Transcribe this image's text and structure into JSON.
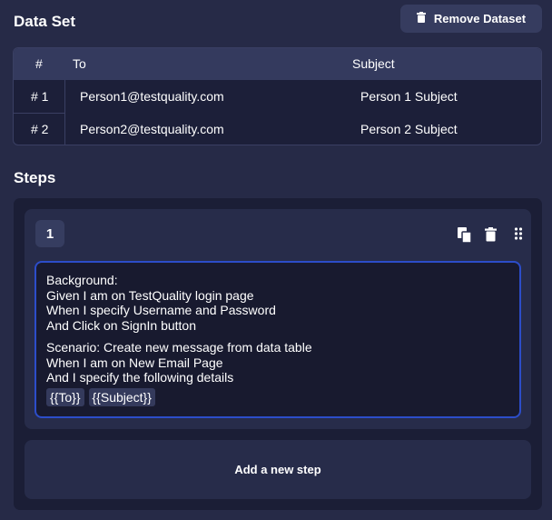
{
  "dataset": {
    "title": "Data Set",
    "remove_label": "Remove Dataset",
    "columns": {
      "num": "#",
      "to": "To",
      "subject": "Subject"
    },
    "rows": [
      {
        "num": "# 1",
        "to": "Person1@testquality.com",
        "subject": "Person 1 Subject"
      },
      {
        "num": "# 2",
        "to": "Person2@testquality.com",
        "subject": "Person 2 Subject"
      }
    ]
  },
  "steps": {
    "title": "Steps",
    "items": [
      {
        "number": "1",
        "lines_a": [
          "Background:",
          "Given I am on TestQuality login page",
          "When I specify Username and Password",
          "And Click on SignIn button"
        ],
        "lines_b": [
          "Scenario: Create new message from data table",
          "When I am on New Email Page",
          "And I specify the following details"
        ],
        "tokens": [
          "{{To}}",
          "{{Subject}}"
        ]
      }
    ],
    "add_label": "Add a new step"
  },
  "icons": [
    "trash-icon",
    "copy-icon",
    "drag-handle-icon"
  ]
}
